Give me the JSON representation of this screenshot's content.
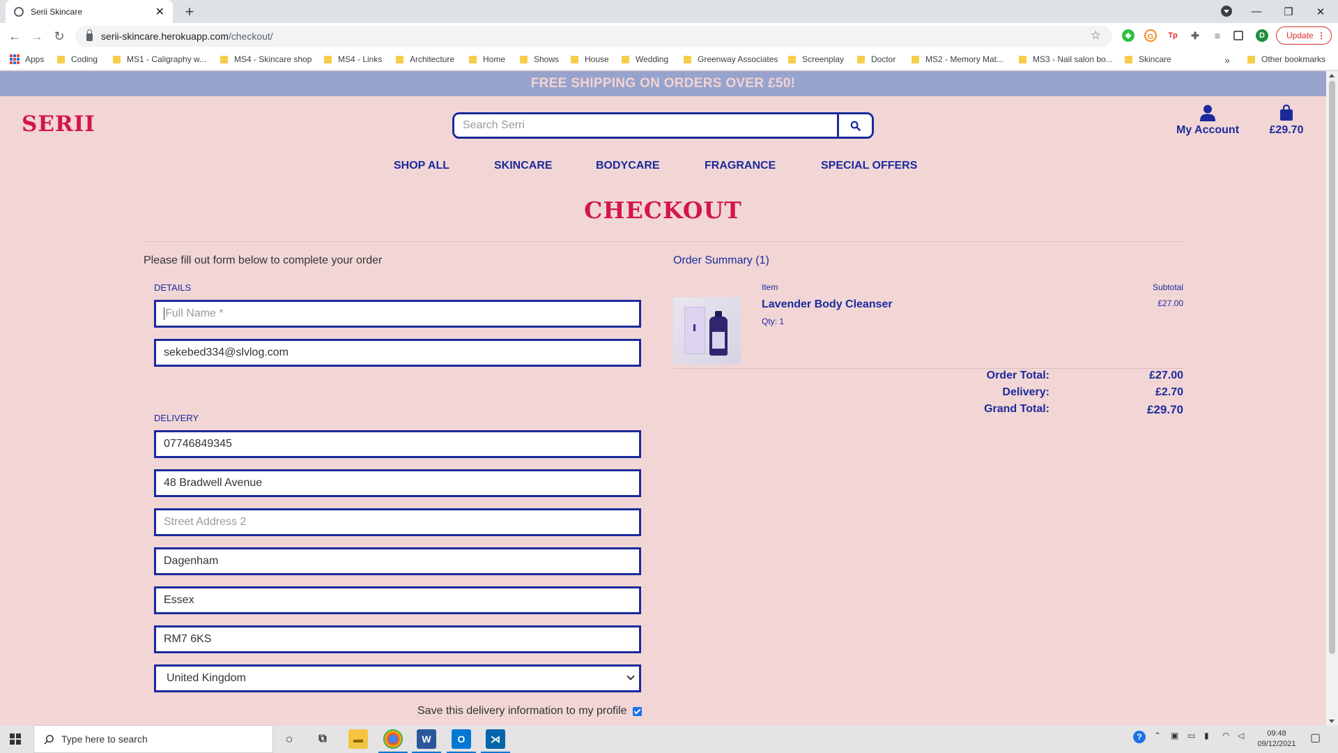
{
  "browser": {
    "tab_title": "Serii Skincare",
    "url_domain": "serii-skincare.herokuapp.com",
    "url_path": "/checkout/",
    "update_label": "Update",
    "profile_initial": "D",
    "bookmarks": [
      "Apps",
      "Coding",
      "MS1 - Caligraphy w...",
      "MS4 - Skincare shop",
      "MS4 - Links",
      "Architecture",
      "Home",
      "Shows",
      "House",
      "Wedding",
      "Greenway Associates",
      "Screenplay",
      "Doctor",
      "MS2 - Memory Mat...",
      "MS3 - Nail salon bo...",
      "Skincare"
    ],
    "other_bookmarks": "Other bookmarks",
    "more_bookmarks": "»"
  },
  "site": {
    "promo": "FREE SHIPPING ON ORDERS OVER £50!",
    "logo": "SERII",
    "search_placeholder": "Search Serri",
    "account_label": "My Account",
    "bag_total": "£29.70",
    "nav": [
      "SHOP ALL",
      "SKINCARE",
      "BODYCARE",
      "FRAGRANCE",
      "SPECIAL OFFERS"
    ],
    "brand_color": "#d3164b",
    "accent_color": "#1b2a9c"
  },
  "checkout": {
    "title": "CHECKOUT",
    "intro": "Please fill out form below to complete your order",
    "details_label": "DETAILS",
    "full_name_placeholder": "Full Name *",
    "email": "sekebed334@slvlog.com",
    "delivery_label": "DELIVERY",
    "phone": "07746849345",
    "street1": "48 Bradwell Avenue",
    "street2_placeholder": "Street Address 2",
    "town": "Dagenham",
    "county": "Essex",
    "postcode": "RM7 6KS",
    "country": "United Kingdom",
    "save_info_label": "Save this delivery information to my profile"
  },
  "summary": {
    "title": "Order Summary (1)",
    "item_header": "Item",
    "subtotal_header": "Subtotal",
    "items": [
      {
        "name": "Lavender Body Cleanser",
        "qty": "Qty: 1",
        "subtotal": "£27.00"
      }
    ],
    "order_total_label": "Order Total:",
    "order_total": "£27.00",
    "delivery_label": "Delivery:",
    "delivery": "£2.70",
    "grand_total_label": "Grand Total:",
    "grand_total": "£29.70"
  },
  "taskbar": {
    "search_placeholder": "Type here to search",
    "time": "09:48",
    "date": "09/12/2021"
  }
}
